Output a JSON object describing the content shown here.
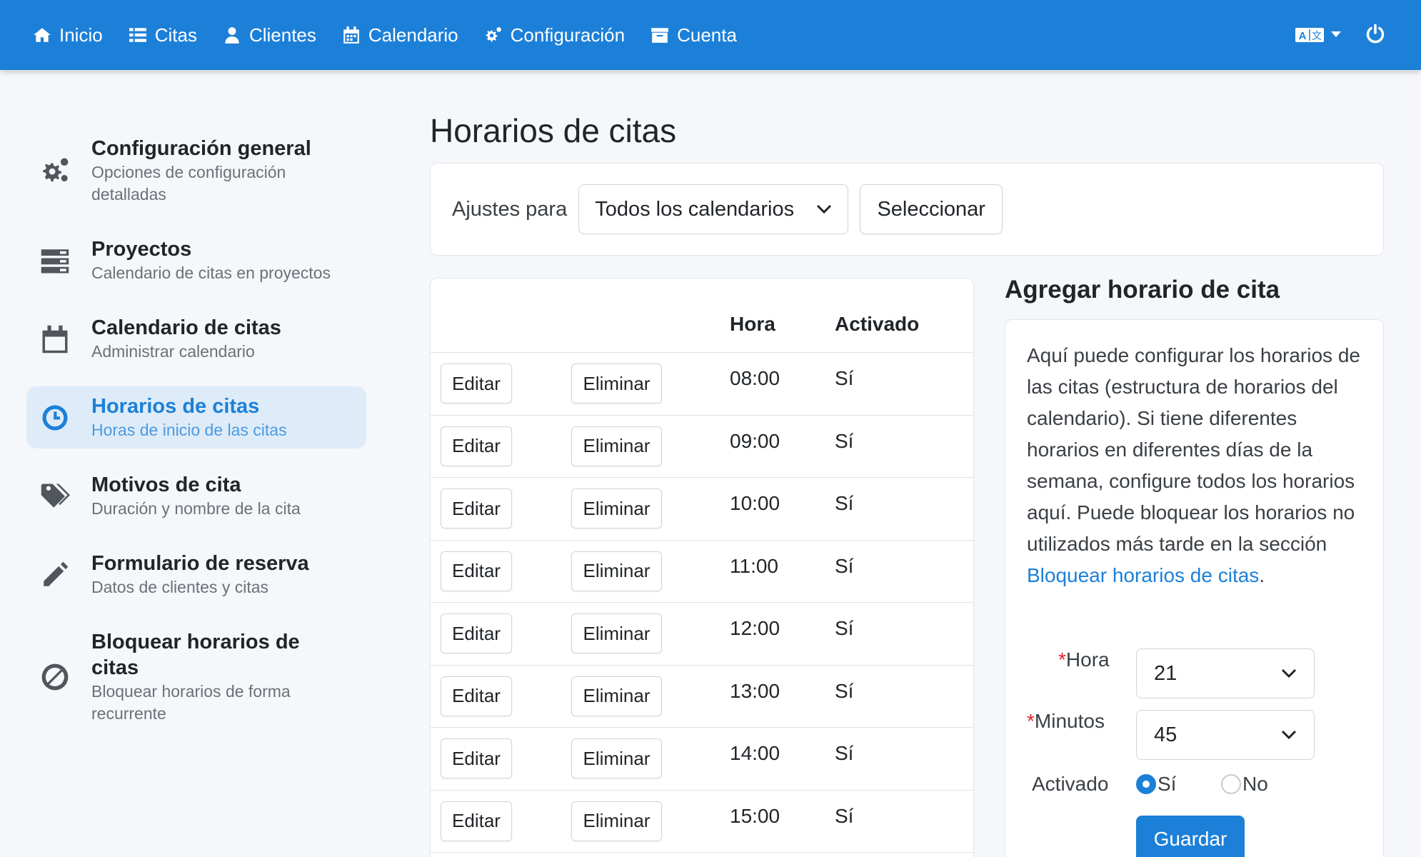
{
  "nav": {
    "items": [
      {
        "label": "Inicio",
        "icon": "home-icon"
      },
      {
        "label": "Citas",
        "icon": "list-icon"
      },
      {
        "label": "Clientes",
        "icon": "user-icon"
      },
      {
        "label": "Calendario",
        "icon": "calendar-icon"
      },
      {
        "label": "Configuración",
        "icon": "gears-icon"
      },
      {
        "label": "Cuenta",
        "icon": "archive-icon"
      }
    ],
    "language_icon": "translate-icon",
    "power_icon": "power-icon"
  },
  "sidebar": {
    "items": [
      {
        "title": "Configuración general",
        "subtitle": "Opciones de configuración detalladas",
        "icon": "gears-icon",
        "active": false
      },
      {
        "title": "Proyectos",
        "subtitle": "Calendario de citas en proyectos",
        "icon": "server-icon",
        "active": false
      },
      {
        "title": "Calendario de citas",
        "subtitle": "Administrar calendario",
        "icon": "calendar-icon",
        "active": false
      },
      {
        "title": "Horarios de citas",
        "subtitle": "Horas de inicio de las citas",
        "icon": "clock-icon",
        "active": true
      },
      {
        "title": "Motivos de cita",
        "subtitle": "Duración y nombre de la cita",
        "icon": "tags-icon",
        "active": false
      },
      {
        "title": "Formulario de reserva",
        "subtitle": "Datos de clientes y citas",
        "icon": "pencil-icon",
        "active": false
      },
      {
        "title": "Bloquear horarios de citas",
        "subtitle": "Bloquear horarios de forma recurrente",
        "icon": "ban-icon",
        "active": false
      }
    ]
  },
  "main": {
    "title": "Horarios de citas",
    "filter": {
      "label": "Ajustes para",
      "selected": "Todos los calendarios",
      "button": "Seleccionar"
    },
    "table": {
      "headers": {
        "time": "Hora",
        "enabled": "Activado"
      },
      "edit_label": "Editar",
      "delete_label": "Eliminar",
      "rows": [
        {
          "time": "08:00",
          "enabled": "Sí"
        },
        {
          "time": "09:00",
          "enabled": "Sí"
        },
        {
          "time": "10:00",
          "enabled": "Sí"
        },
        {
          "time": "11:00",
          "enabled": "Sí"
        },
        {
          "time": "12:00",
          "enabled": "Sí"
        },
        {
          "time": "13:00",
          "enabled": "Sí"
        },
        {
          "time": "14:00",
          "enabled": "Sí"
        },
        {
          "time": "15:00",
          "enabled": "Sí"
        }
      ]
    }
  },
  "add_panel": {
    "title": "Agregar horario de cita",
    "description": "Aquí puede configurar los horarios de las citas (estructura de horarios del calendario). Si tiene diferentes horarios en diferentes días de la semana, configure todos los horarios aquí. Puede bloquear los horarios no utilizados más tarde en la sección ",
    "link_text": "Bloquear horarios de citas",
    "description_end": ".",
    "required_mark": "*",
    "hour_label": "Hora",
    "hour_value": "21",
    "minutes_label": "Minutos",
    "minutes_value": "45",
    "enabled_label": "Activado",
    "option_yes": "Sí",
    "option_no": "No",
    "selected_option": "yes",
    "save_label": "Guardar"
  },
  "colors": {
    "primary": "#1c80d8",
    "active_bg": "#deebf8",
    "required": "#e02424"
  }
}
